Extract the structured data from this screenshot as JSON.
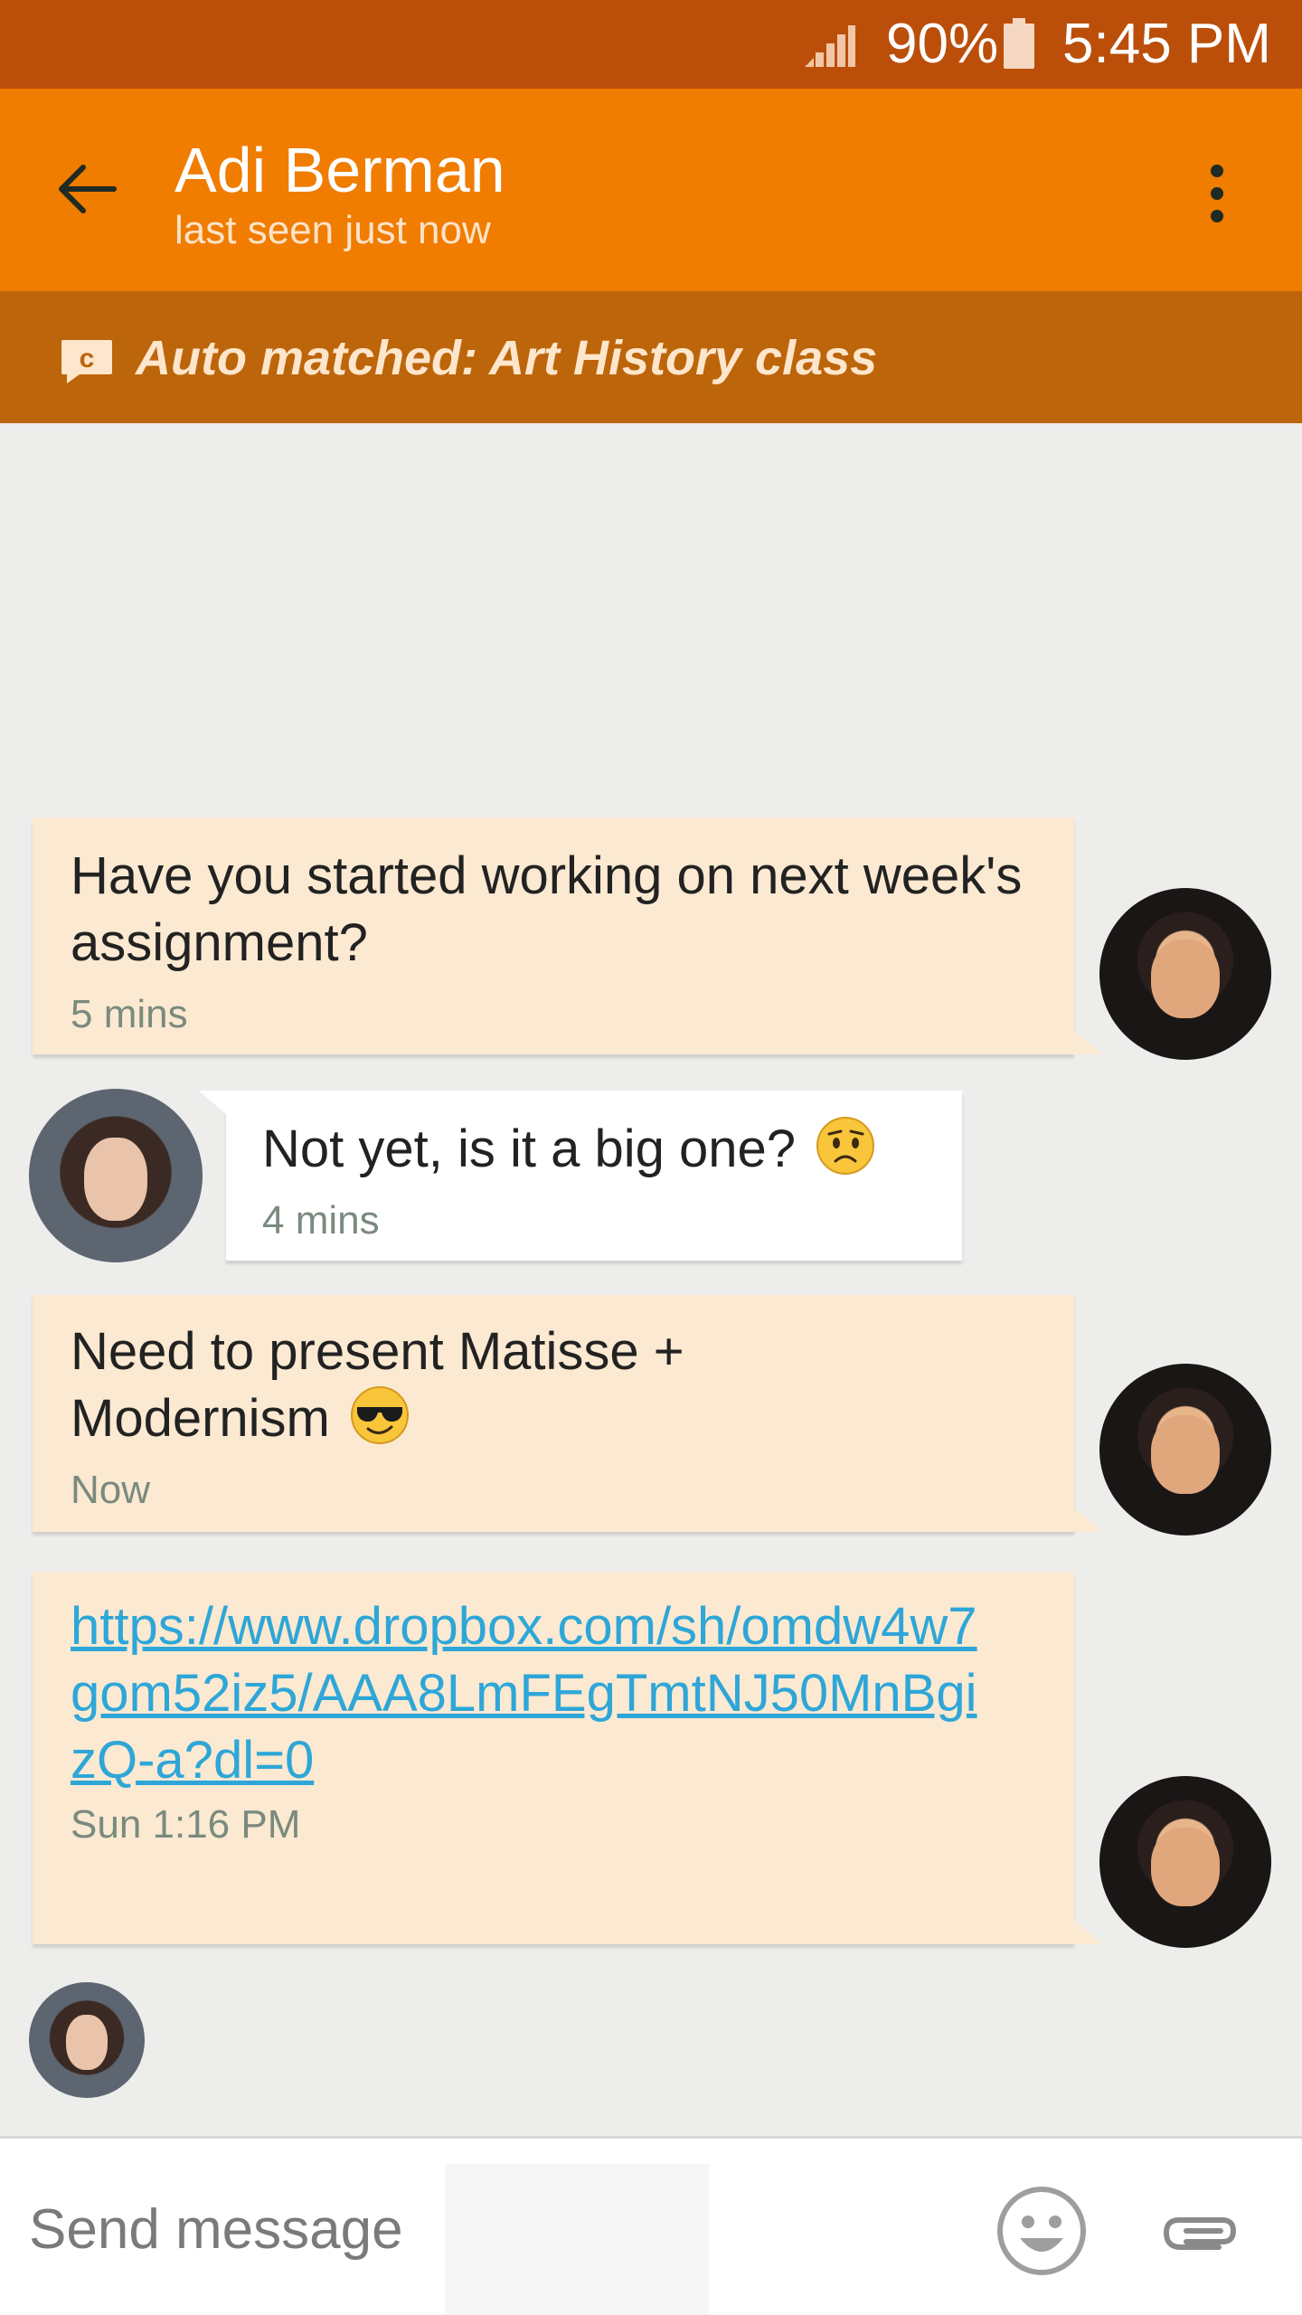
{
  "status_bar": {
    "battery_percent": "90%",
    "time": "5:45 PM"
  },
  "header": {
    "contact_name": "Adi Berman",
    "contact_status": "last seen just now"
  },
  "banner": {
    "text": "Auto matched: Art History class"
  },
  "messages": [
    {
      "direction": "incoming",
      "text": "Have you started working on next week's assignment?",
      "time": "5 mins"
    },
    {
      "direction": "outgoing",
      "text": "Not yet, is it a big one?",
      "emoji": "worried-face-emoji",
      "time": "4 mins"
    },
    {
      "direction": "incoming",
      "text": "Need to present Matisse + Modernism",
      "emoji": "sunglasses-face-emoji",
      "time": "Now"
    },
    {
      "direction": "incoming",
      "link": "https://www.dropbox.com/sh/omdw4w7gom52iz5/AAA8LmFEgTmtNJ50MnBgizQ-a?dl=0",
      "time": "Sun 1:16 PM"
    }
  ],
  "composer": {
    "placeholder": "Send message"
  },
  "colors": {
    "status_bar": "#bb4f0a",
    "app_bar": "#f07c00",
    "banner": "#bd650a",
    "incoming_bubble": "#fbe9d1",
    "outgoing_bubble": "#ffffff",
    "link": "#2ea6d8",
    "chat_background": "#ededeb"
  }
}
